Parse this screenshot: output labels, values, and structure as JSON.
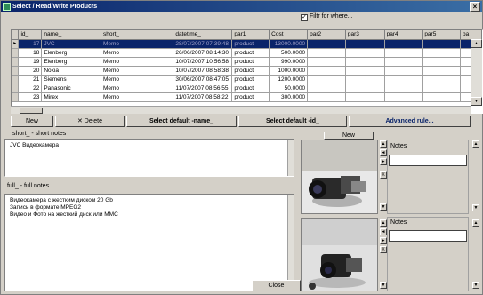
{
  "window": {
    "title": "Select / Read/Write Products"
  },
  "filter": {
    "label": "Filtr for where...",
    "checked": true
  },
  "grid": {
    "columns": [
      "id_",
      "name_",
      "short_",
      "datetime_",
      "par1",
      "Cost",
      "par2",
      "par3",
      "par4",
      "par5",
      "pa"
    ],
    "rows": [
      [
        "17",
        "JVC",
        "Memo",
        "28/07/2007 07:39:48",
        "product",
        "13000.0000",
        "",
        "",
        "",
        "",
        ""
      ],
      [
        "18",
        "Elenberg",
        "Memo",
        "26/06/2007 08:14:30",
        "product",
        "500.0000",
        "",
        "",
        "",
        "",
        ""
      ],
      [
        "19",
        "Elenberg",
        "Memo",
        "10/07/2007 10:56:58",
        "product",
        "990.0000",
        "",
        "",
        "",
        "",
        ""
      ],
      [
        "20",
        "Nokia",
        "Memo",
        "10/07/2007 08:58:38",
        "product",
        "1000.0000",
        "",
        "",
        "",
        "",
        ""
      ],
      [
        "21",
        "Siemens",
        "Memo",
        "30/06/2007 08:47:05",
        "product",
        "1200.0000",
        "",
        "",
        "",
        "",
        ""
      ],
      [
        "22",
        "Panasonic",
        "Memo",
        "11/07/2007 08:56:55",
        "product",
        "50.0000",
        "",
        "",
        "",
        "",
        ""
      ],
      [
        "23",
        "Mirex",
        "Memo",
        "11/07/2007 08:58:22",
        "product",
        "300.0000",
        "",
        "",
        "",
        "",
        ""
      ]
    ],
    "selected_row": 0
  },
  "toolbar": {
    "new_label": "New",
    "delete_label": "Delete",
    "select_name_label": "Select default -name_",
    "select_id_label": "Select default -id_",
    "advanced_label": "Advanced rule..."
  },
  "short_notes": {
    "label": "short_  - short notes",
    "text": "JVC Видеокамера"
  },
  "full_notes": {
    "label": "full_  - full notes",
    "lines": [
      "Видеокамера с жестким диском 20 Gb",
      "Запись в формате MPEG2",
      "Видео и Фото на жесткий диск или MMC"
    ]
  },
  "images": {
    "new_label": "New",
    "notes_label_1": "Notes",
    "notes_label_2": "Notes",
    "delete_mark": "X",
    "close_label": "Close"
  }
}
